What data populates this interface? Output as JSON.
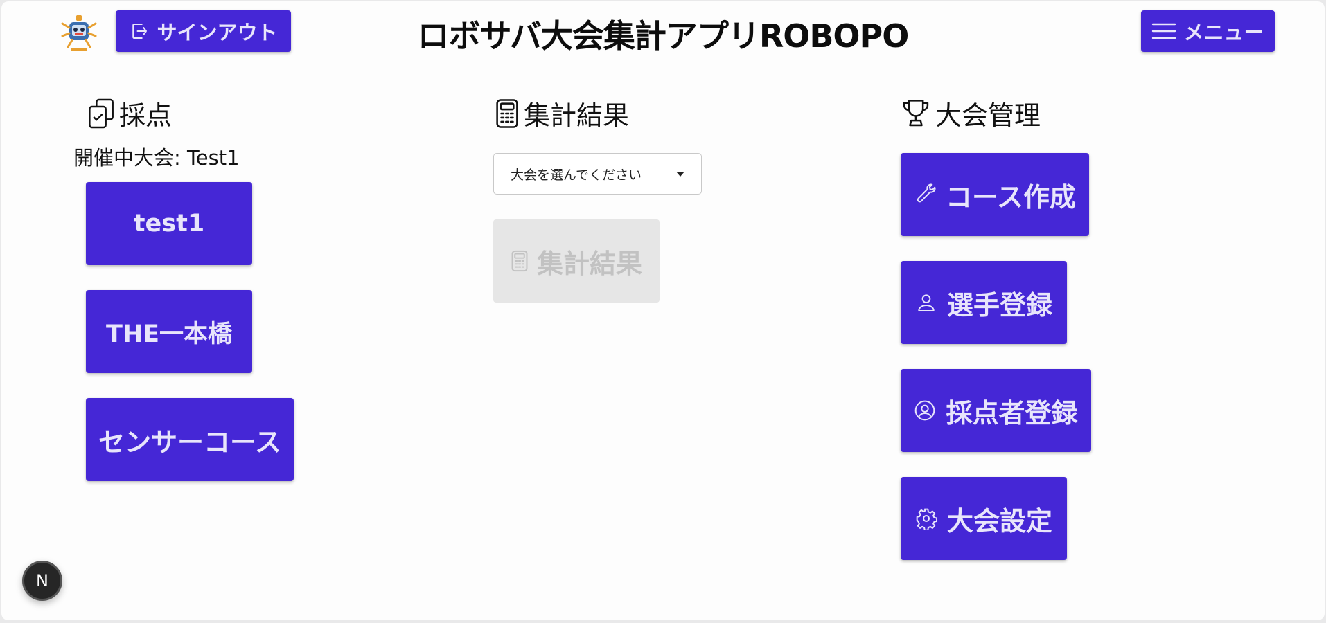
{
  "header": {
    "title": "ロボサバ大会集計アプリROBOPO",
    "signout_label": "サインアウト",
    "menu_label": "メニュー"
  },
  "scoring": {
    "heading": "採点",
    "active_competition": "開催中大会: Test1",
    "courses": [
      "test1",
      "THE一本橋",
      "センサーコース"
    ]
  },
  "results": {
    "heading": "集計結果",
    "select_value": "大会を選んでください",
    "button_label": "集計結果"
  },
  "admin": {
    "heading": "大会管理",
    "items": [
      {
        "label": "コース作成",
        "icon": "wrench-icon"
      },
      {
        "label": "選手登録",
        "icon": "user-icon"
      },
      {
        "label": "採点者登録",
        "icon": "user-circle-icon"
      },
      {
        "label": "大会設定",
        "icon": "gear-icon"
      }
    ]
  },
  "dev_badge": "N",
  "colors": {
    "accent": "#4527d6",
    "button_text": "#e8e5fb",
    "disabled_bg": "#e6e6e6"
  }
}
